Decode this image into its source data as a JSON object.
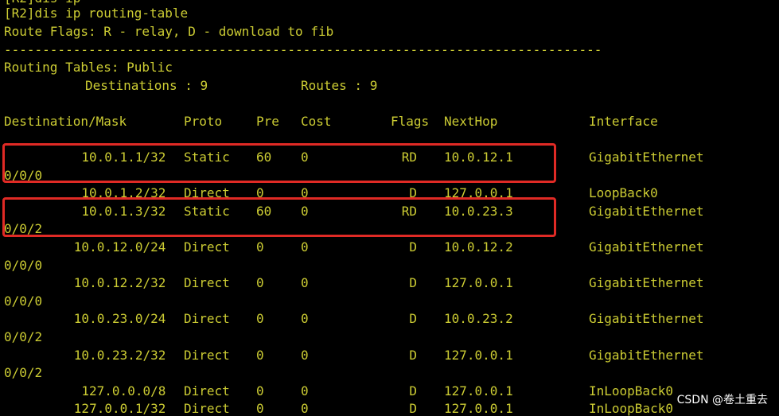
{
  "terminal": {
    "top_cut_line": "[R2]dis ip",
    "command": "[R2]dis ip routing-table",
    "flags_legend": "Route Flags: R - relay, D - download to fib",
    "separator": "------------------------------------------------------------------------------",
    "tables_title": "Routing Tables: Public",
    "destinations_label": "Destinations : 9",
    "routes_label": "Routes : 9",
    "headers": [
      "Destination/Mask",
      "Proto",
      "Pre",
      "Cost",
      "Flags",
      "NextHop",
      "Interface"
    ],
    "rows": [
      {
        "dest": "10.0.1.1/32",
        "proto": "Static",
        "pre": "60",
        "cost": "0",
        "flags": "RD",
        "nexthop": "10.0.12.1",
        "iface": "GigabitEthernet",
        "iface_wrap": "0/0/0",
        "highlight": true
      },
      {
        "dest": "10.0.1.2/32",
        "proto": "Direct",
        "pre": "0",
        "cost": "0",
        "flags": "D",
        "nexthop": "127.0.0.1",
        "iface": "LoopBack0",
        "iface_wrap": "",
        "highlight": false
      },
      {
        "dest": "10.0.1.3/32",
        "proto": "Static",
        "pre": "60",
        "cost": "0",
        "flags": "RD",
        "nexthop": "10.0.23.3",
        "iface": "GigabitEthernet",
        "iface_wrap": "0/0/2",
        "highlight": true
      },
      {
        "dest": "10.0.12.0/24",
        "proto": "Direct",
        "pre": "0",
        "cost": "0",
        "flags": "D",
        "nexthop": "10.0.12.2",
        "iface": "GigabitEthernet",
        "iface_wrap": "0/0/0",
        "highlight": false
      },
      {
        "dest": "10.0.12.2/32",
        "proto": "Direct",
        "pre": "0",
        "cost": "0",
        "flags": "D",
        "nexthop": "127.0.0.1",
        "iface": "GigabitEthernet",
        "iface_wrap": "0/0/0",
        "highlight": false
      },
      {
        "dest": "10.0.23.0/24",
        "proto": "Direct",
        "pre": "0",
        "cost": "0",
        "flags": "D",
        "nexthop": "10.0.23.2",
        "iface": "GigabitEthernet",
        "iface_wrap": "0/0/2",
        "highlight": false
      },
      {
        "dest": "10.0.23.2/32",
        "proto": "Direct",
        "pre": "0",
        "cost": "0",
        "flags": "D",
        "nexthop": "127.0.0.1",
        "iface": "GigabitEthernet",
        "iface_wrap": "0/0/2",
        "highlight": false
      },
      {
        "dest": "127.0.0.0/8",
        "proto": "Direct",
        "pre": "0",
        "cost": "0",
        "flags": "D",
        "nexthop": "127.0.0.1",
        "iface": "InLoopBack0",
        "iface_wrap": "",
        "highlight": false
      },
      {
        "dest": "127.0.0.1/32",
        "proto": "Direct",
        "pre": "0",
        "cost": "0",
        "flags": "D",
        "nexthop": "127.0.0.1",
        "iface": "InLoopBack0",
        "iface_wrap": "",
        "highlight": false
      }
    ]
  },
  "watermark": "CSDN @卷土重去",
  "colors": {
    "background": "#000000",
    "text": "#cccc33",
    "highlight_box": "#e02a25"
  }
}
